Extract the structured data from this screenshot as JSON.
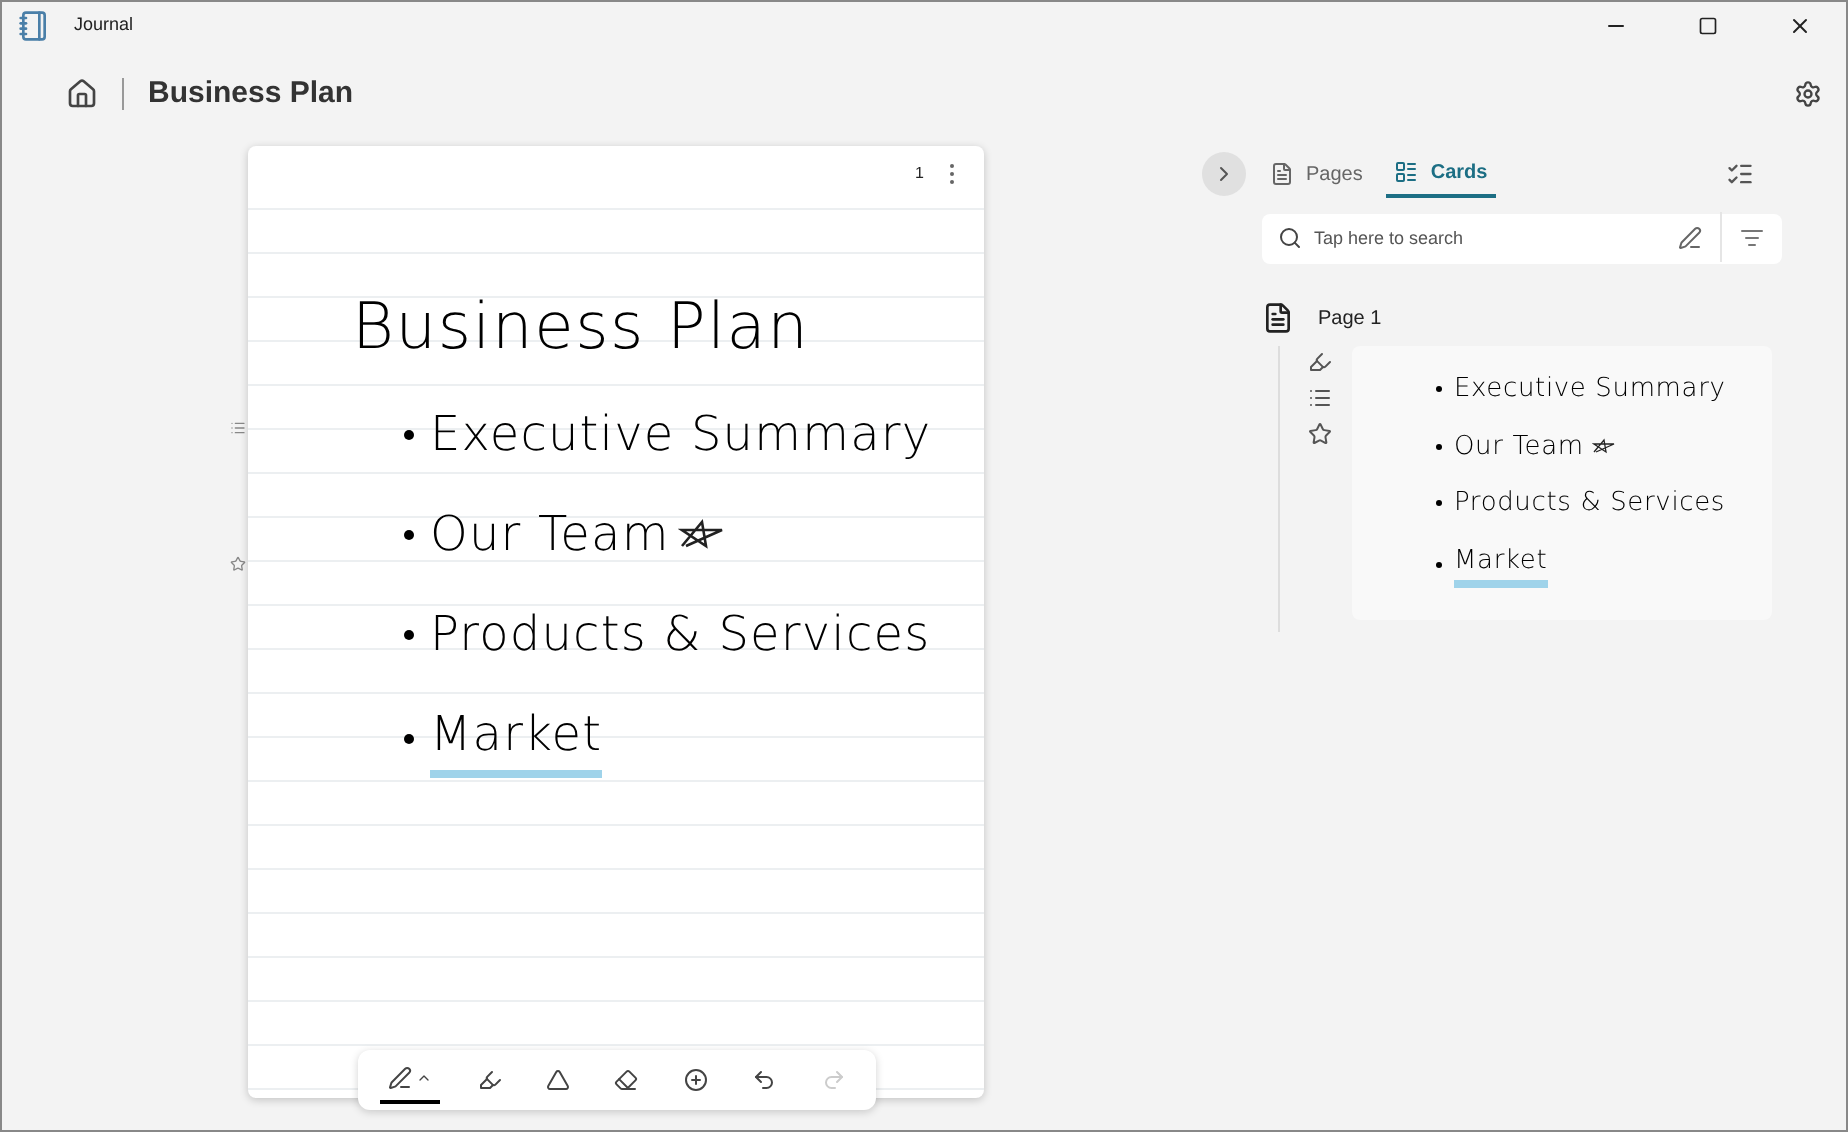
{
  "window": {
    "title": "Journal"
  },
  "header": {
    "title": "Business Plan"
  },
  "page": {
    "number": "1",
    "title": "Business Plan",
    "items": [
      {
        "text": "Executive Summary",
        "highlighted": false,
        "starred": false
      },
      {
        "text": "Our Team",
        "highlighted": false,
        "starred": true
      },
      {
        "text": "Products & Services",
        "highlighted": false,
        "starred": false
      },
      {
        "text": "Market",
        "highlighted": true,
        "starred": false
      }
    ]
  },
  "toolbar": [
    {
      "kind": "pen",
      "selected": true,
      "disabled": false
    },
    {
      "kind": "highlighter",
      "selected": false,
      "disabled": false
    },
    {
      "kind": "lasso",
      "selected": false,
      "disabled": false
    },
    {
      "kind": "eraser",
      "selected": false,
      "disabled": false
    },
    {
      "kind": "add",
      "selected": false,
      "disabled": false
    },
    {
      "kind": "undo",
      "selected": false,
      "disabled": false
    },
    {
      "kind": "redo",
      "selected": false,
      "disabled": true
    }
  ],
  "panel": {
    "tabs": [
      {
        "label": "Pages",
        "kind": "pages",
        "selected": false
      },
      {
        "label": "Cards",
        "kind": "cards",
        "selected": true
      }
    ],
    "search": {
      "placeholder": "Tap here to search"
    },
    "pages": [
      {
        "title": "Page 1",
        "lines": [
          {
            "text": "Executive Summary",
            "highlighted": false,
            "starred": false
          },
          {
            "text": "Our Team",
            "highlighted": false,
            "starred": true
          },
          {
            "text": "Products & Services",
            "highlighted": false,
            "starred": false
          },
          {
            "text": "Market",
            "highlighted": true,
            "starred": false
          }
        ]
      }
    ]
  }
}
